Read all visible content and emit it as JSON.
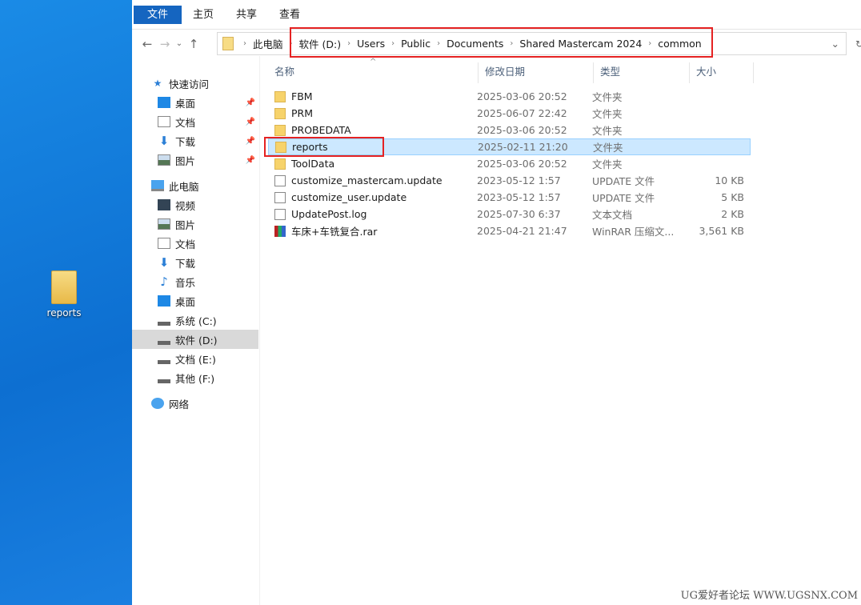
{
  "desktop": {
    "icon_label": "reports"
  },
  "ribbon": {
    "tabs": [
      "文件",
      "主页",
      "共享",
      "查看"
    ]
  },
  "address": {
    "segments": [
      "此电脑",
      "软件 (D:)",
      "Users",
      "Public",
      "Documents",
      "Shared Mastercam 2024",
      "common"
    ]
  },
  "sidebar": {
    "quick_access": "快速访问",
    "quick_items": [
      "桌面",
      "文档",
      "下载",
      "图片"
    ],
    "this_pc": "此电脑",
    "pc_items": [
      "视频",
      "图片",
      "文档",
      "下载",
      "音乐",
      "桌面",
      "系统 (C:)",
      "软件 (D:)",
      "文档 (E:)",
      "其他 (F:)"
    ],
    "network": "网络"
  },
  "columns": [
    "名称",
    "修改日期",
    "类型",
    "大小"
  ],
  "files": [
    {
      "name": "FBM",
      "date": "2025-03-06 20:52",
      "type": "文件夹",
      "size": ""
    },
    {
      "name": "PRM",
      "date": "2025-06-07 22:42",
      "type": "文件夹",
      "size": ""
    },
    {
      "name": "PROBEDATA",
      "date": "2025-03-06 20:52",
      "type": "文件夹",
      "size": ""
    },
    {
      "name": "reports",
      "date": "2025-02-11 21:20",
      "type": "文件夹",
      "size": ""
    },
    {
      "name": "ToolData",
      "date": "2025-03-06 20:52",
      "type": "文件夹",
      "size": ""
    },
    {
      "name": "customize_mastercam.update",
      "date": "2023-05-12 1:57",
      "type": "UPDATE 文件",
      "size": "10 KB"
    },
    {
      "name": "customize_user.update",
      "date": "2023-05-12 1:57",
      "type": "UPDATE 文件",
      "size": "5 KB"
    },
    {
      "name": "UpdatePost.log",
      "date": "2025-07-30 6:37",
      "type": "文本文档",
      "size": "2 KB"
    },
    {
      "name": "车床+车铣复合.rar",
      "date": "2025-04-21 21:47",
      "type": "WinRAR 压缩文...",
      "size": "3,561 KB"
    }
  ],
  "watermark": "UG爱好者论坛 WWW.UGSNX.COM"
}
